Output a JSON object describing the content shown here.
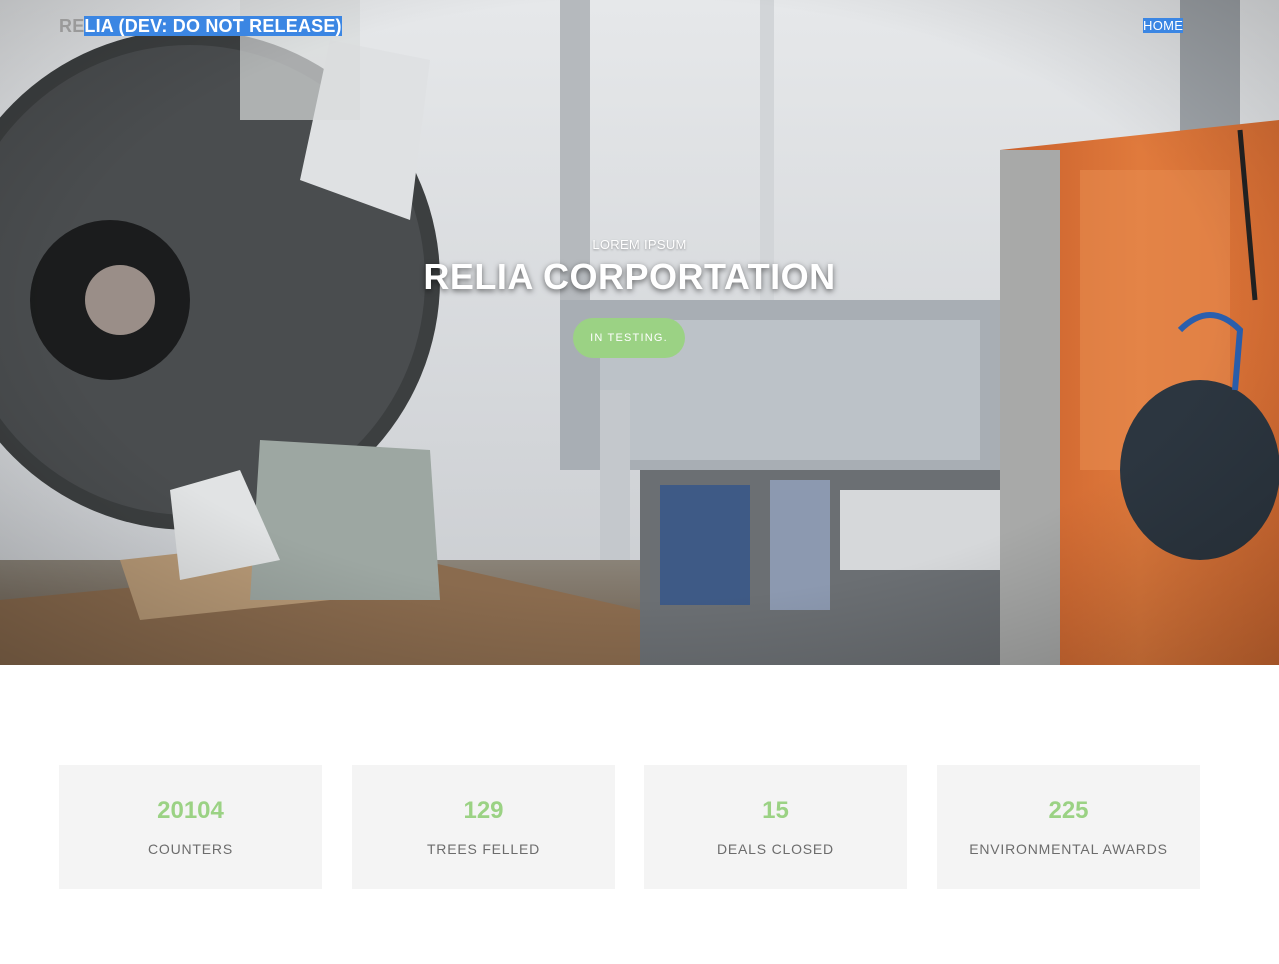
{
  "nav": {
    "brand_prefix": "RE",
    "brand_selected": "LIA (DEV: DO NOT RELEASE)",
    "links": [
      {
        "label": "HOME"
      }
    ],
    "selection_color": "#3b86e3"
  },
  "hero": {
    "kicker": "LOREM IPSUM",
    "title": "RELIA CORPORTATION",
    "button_label": "IN TESTING.",
    "button_color": "#9bd284"
  },
  "counters": [
    {
      "value": "20104",
      "label": "COUNTERS"
    },
    {
      "value": "129",
      "label": "TREES FELLED"
    },
    {
      "value": "15",
      "label": "DEALS CLOSED"
    },
    {
      "value": "225",
      "label": "ENVIRONMENTAL AWARDS"
    }
  ],
  "colors": {
    "accent": "#9bd284",
    "counter_bg": "#f4f4f4",
    "counter_label": "#6c6c6c"
  }
}
